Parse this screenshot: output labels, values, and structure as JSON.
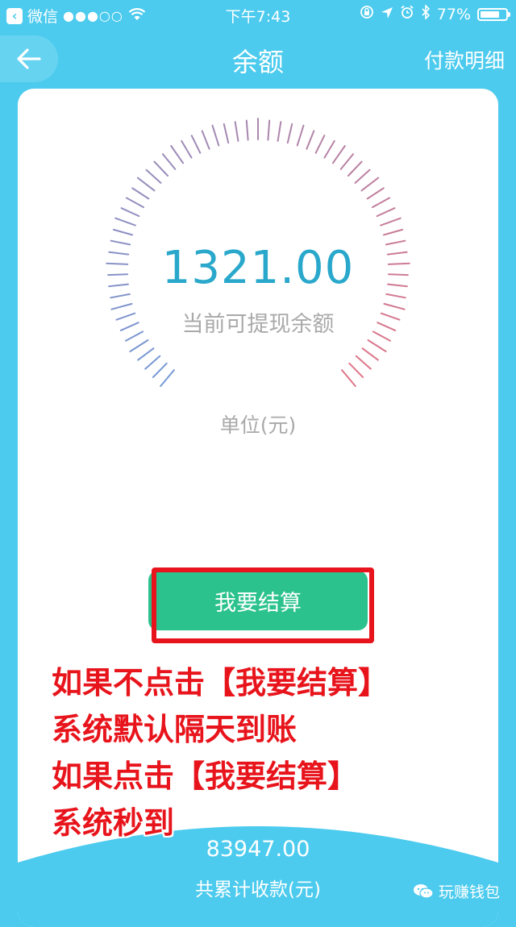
{
  "status_bar": {
    "carrier": "微信",
    "signal": "●●●○○",
    "time": "下午7:43",
    "battery": "77%",
    "battery_level": 0.77
  },
  "nav": {
    "title": "余额",
    "right_link": "付款明细"
  },
  "balance": {
    "value": "1321.00",
    "label": "当前可提现余额",
    "unit": "单位(元)"
  },
  "action": {
    "settle_label": "我要结算"
  },
  "annotations": [
    "如果不点击【我要结算】",
    "系统默认隔天到账",
    "如果点击【我要结算】",
    "系统秒到"
  ],
  "totals": {
    "value": "83947.00",
    "label": "共累计收款(元)"
  },
  "watermark": {
    "text": "玩赚钱包"
  },
  "colors": {
    "background": "#4ccbee",
    "accent_text": "#2aa8cc",
    "button": "#2bc28e",
    "annotation": "#e8141c"
  },
  "icons": [
    "back-arrow-icon",
    "wifi-icon",
    "lock-rotation-icon",
    "location-icon",
    "alarm-icon",
    "bluetooth-icon",
    "battery-icon",
    "wechat-icon"
  ]
}
